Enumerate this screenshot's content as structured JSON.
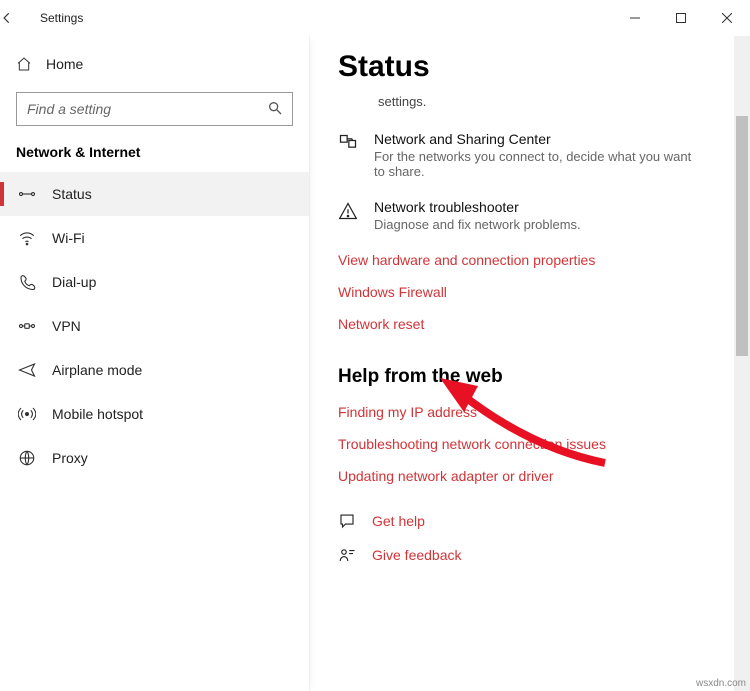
{
  "window": {
    "title": "Settings"
  },
  "home": {
    "label": "Home"
  },
  "search": {
    "placeholder": "Find a setting"
  },
  "category": {
    "label": "Network & Internet"
  },
  "nav": {
    "items": [
      {
        "label": "Status"
      },
      {
        "label": "Wi-Fi"
      },
      {
        "label": "Dial-up"
      },
      {
        "label": "VPN"
      },
      {
        "label": "Airplane mode"
      },
      {
        "label": "Mobile hotspot"
      },
      {
        "label": "Proxy"
      }
    ]
  },
  "page": {
    "heading": "Status",
    "tailtext": "settings.",
    "sharing": {
      "title": "Network and Sharing Center",
      "desc": "For the networks you connect to, decide what you want to share."
    },
    "trouble": {
      "title": "Network troubleshooter",
      "desc": "Diagnose and fix network problems."
    },
    "links": {
      "hw": "View hardware and connection properties",
      "firewall": "Windows Firewall",
      "reset": "Network reset"
    },
    "webhelp": {
      "heading": "Help from the web",
      "ip": "Finding my IP address",
      "tsh": "Troubleshooting network connection issues",
      "upd": "Updating network adapter or driver"
    },
    "footer": {
      "gethelp": "Get help",
      "feedback": "Give feedback"
    }
  },
  "watermark": "wsxdn.com"
}
